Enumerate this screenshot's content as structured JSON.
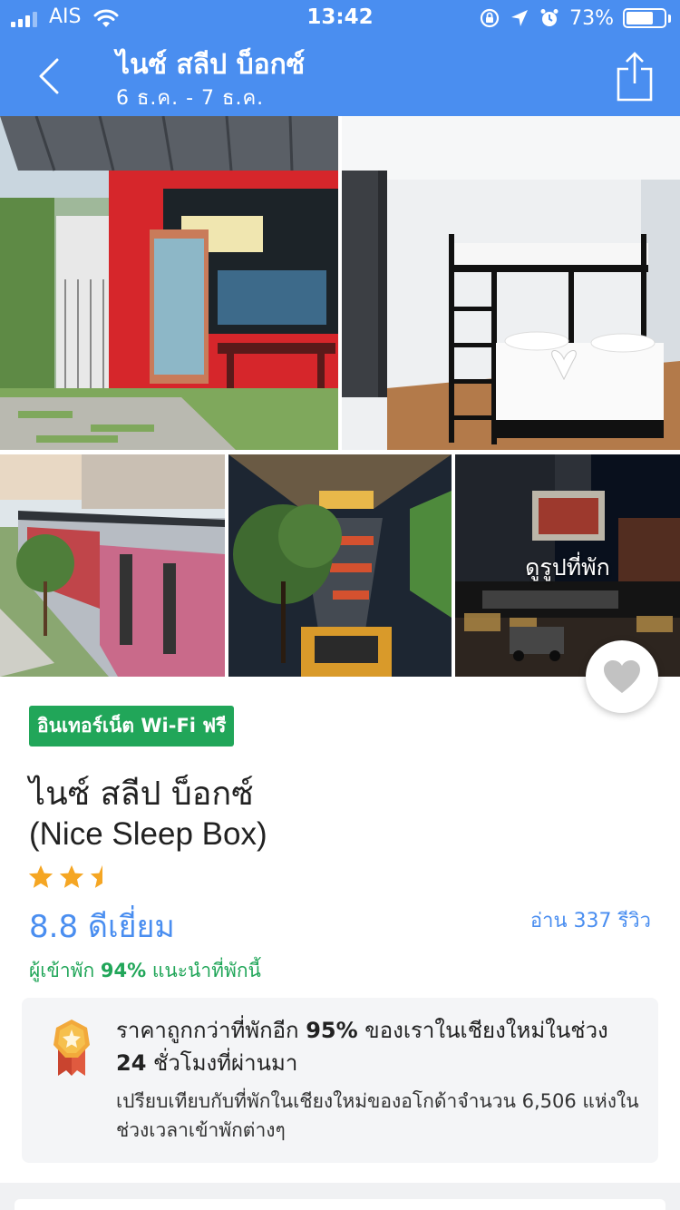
{
  "status_bar": {
    "carrier": "AIS",
    "time": "13:42",
    "battery_percent": "73%",
    "battery_level": 0.73,
    "icons": [
      "signal-icon",
      "wifi-icon",
      "rotation-lock-icon",
      "location-icon",
      "alarm-icon",
      "battery-icon"
    ]
  },
  "nav": {
    "title": "ไนซ์ สลีป บ็อกซ์",
    "dates": "6 ธ.ค. - 7 ธ.ค.",
    "icons": [
      "back-icon",
      "share-icon"
    ]
  },
  "gallery": {
    "view_photos_label": "ดูรูปที่พัก",
    "photos": [
      "storefront-photo",
      "bunk-bed-room-photo",
      "container-building-photo",
      "night-courtyard-photo",
      "street-night-photo"
    ]
  },
  "hotel": {
    "amenity_badge": "อินเทอร์เน็ต Wi-Fi ฟรี",
    "name_th": "ไนซ์ สลีป บ็อกซ์",
    "name_en": "(Nice Sleep Box)",
    "star_rating": 2.5,
    "score": "8.8 ดีเยี่ยม",
    "reviews_label": "อ่าน 337 รีวิว",
    "recommend_prefix": "ผู้เข้าพัก ",
    "recommend_percent": "94%",
    "recommend_suffix": " แนะนำที่พักนี้"
  },
  "deal": {
    "title_prefix": "ราคาถูกกว่าที่พักอีก ",
    "title_percent": "95%",
    "title_mid": " ของเราในเชียงใหม่ในช่วง ",
    "title_hours": "24",
    "title_suffix": " ชั่วโมงที่ผ่านมา",
    "subtitle": "เปรียบเทียบกับที่พักในเชียงใหม่ของอโกด้าจำนวน 6,506 แห่งในช่วงเวลาเข้าพักต่างๆ",
    "icon": "award-badge-icon"
  },
  "colors": {
    "header_blue": "#4a8ef0",
    "badge_green": "#21a659",
    "star_orange": "#f5a623",
    "link_blue": "#4a8ef0"
  }
}
